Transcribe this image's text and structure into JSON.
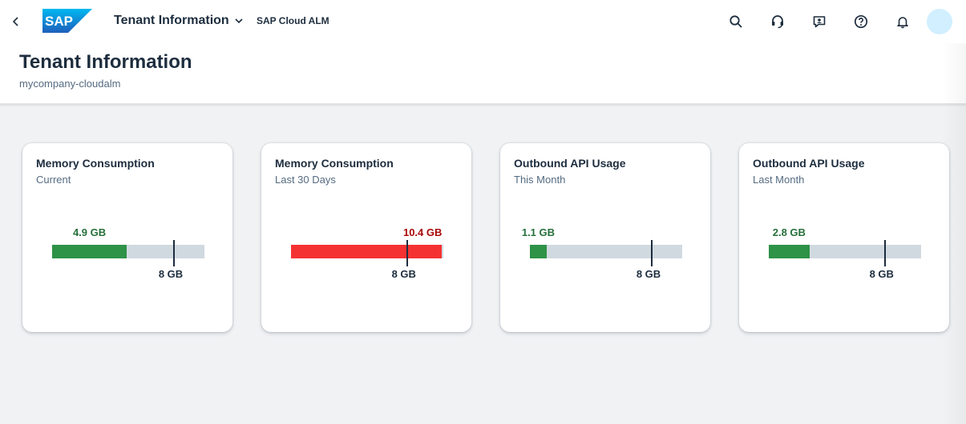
{
  "shell": {
    "logo_text": "SAP",
    "app_title": "Tenant Information",
    "product_name": "SAP Cloud ALM",
    "icons": [
      "chevron-left-icon",
      "chevron-down-icon",
      "search-icon",
      "headset-icon",
      "feedback-icon",
      "help-icon",
      "bell-icon"
    ]
  },
  "header": {
    "title": "Tenant Information",
    "subtitle": "mycompany-cloudalm"
  },
  "colors": {
    "good": "#2e9247",
    "critical": "#f53232",
    "good_text": "#256f3a",
    "critical_text": "#aa0808",
    "track": "#d1d9e0",
    "avatar": "#d1efff"
  },
  "cards": [
    {
      "title": "Memory Consumption",
      "subtitle": "Current",
      "value_label": "4.9 GB",
      "target_label": "8 GB",
      "value": 4.9,
      "target": 8,
      "max": 10,
      "status": "good"
    },
    {
      "title": "Memory Consumption",
      "subtitle": "Last 30 Days",
      "value_label": "10.4 GB",
      "target_label": "8 GB",
      "value": 10.4,
      "target": 8,
      "max": 10.5,
      "status": "critical"
    },
    {
      "title": "Outbound API Usage",
      "subtitle": "This Month",
      "value_label": "1.1 GB",
      "target_label": "8 GB",
      "value": 1.1,
      "target": 8,
      "max": 10,
      "status": "good"
    },
    {
      "title": "Outbound API Usage",
      "subtitle": "Last Month",
      "value_label": "2.8 GB",
      "target_label": "8 GB",
      "value": 2.8,
      "target": 8,
      "max": 10.5,
      "status": "good"
    }
  ]
}
